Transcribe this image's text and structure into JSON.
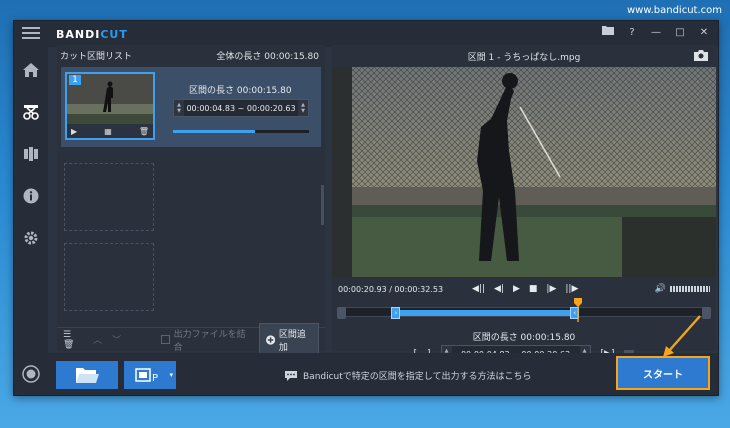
{
  "watermark": "www.bandicut.com",
  "app": {
    "logo_a": "BANDI",
    "logo_b": "CUT"
  },
  "left_panel": {
    "title": "カット区間リスト",
    "total_length": "全体の長さ 00:00:15.80",
    "clip": {
      "number": "1",
      "length_label": "区間の長さ 00:00:15.80",
      "start": "00:00:04.83",
      "separator": "~",
      "end": "00:00:20.63",
      "progress_fraction": 0.6
    },
    "footer": {
      "merge_label": "出力ファイルを結合",
      "add_label": "区間追加"
    }
  },
  "right_panel": {
    "title": "区間 1 - うちっぱなし.mpg",
    "time_display": "00:00:20.93 / 00:00:32.53",
    "segment_length": "区間の長さ 00:00:15.80",
    "segment_start": "00:00:04.83",
    "segment_separator": "~",
    "segment_end": "00:00:20.63",
    "bracket_left": "[",
    "bracket_right": "]",
    "timeline": {
      "start_fraction": 0.148,
      "end_fraction": 0.634,
      "playhead_fraction": 0.643
    }
  },
  "bottom_bar": {
    "info_text": "Bandicutで特定の区間を指定して出力する方法はこちら",
    "start_label": "スタート"
  },
  "colors": {
    "accent": "#3fa0f0",
    "button_blue": "#2d7ad0",
    "highlight": "#f3a51e"
  }
}
